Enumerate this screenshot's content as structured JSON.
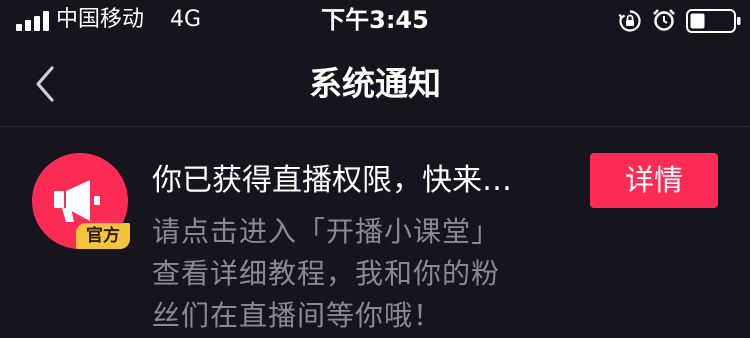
{
  "status_bar": {
    "carrier": "中国移动",
    "network": "4G",
    "time": "下午3:45"
  },
  "nav": {
    "title": "系统通知"
  },
  "message": {
    "title": "你已获得直播权限，快来…",
    "body_lines": [
      "请点击进入「开播小课堂」",
      "查看详细教程，我和你的粉",
      "丝们在直播间等你哦！"
    ],
    "badge": "官方",
    "detail_button": "详情",
    "avatar_icon": "megaphone-icon"
  },
  "colors": {
    "background": "#16151d",
    "accent": "#fe2c55",
    "badge": "#f6c33d",
    "secondary_text": "#8a8991"
  }
}
